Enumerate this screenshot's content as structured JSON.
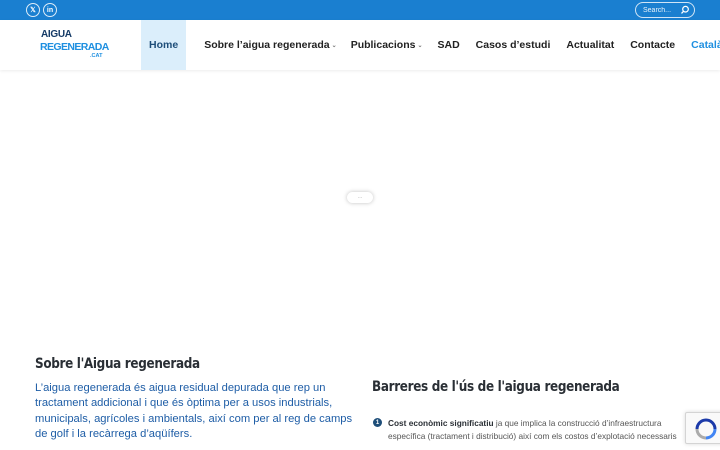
{
  "topbar": {
    "social": [
      {
        "icon": "x-twitter-icon",
        "glyph": "𝕏"
      },
      {
        "icon": "linkedin-icon",
        "glyph": "in"
      }
    ],
    "search": {
      "placeholder": "Search..."
    }
  },
  "header": {
    "logo": {
      "line1": "AIGUA",
      "line2": "REGENERADA",
      "line3": ".CAT"
    },
    "nav": [
      {
        "label": "Home",
        "active": true
      },
      {
        "label": "Sobre l’aigua regenerada",
        "has_submenu": true
      },
      {
        "label": "Publicacions",
        "has_submenu": true
      },
      {
        "label": "SAD"
      },
      {
        "label": "Casos d’estudi"
      },
      {
        "label": "Actualitat"
      },
      {
        "label": "Contacte"
      },
      {
        "label": "Català",
        "has_submenu": true
      }
    ]
  },
  "slider": {
    "loader_text": "⋯"
  },
  "left": {
    "title": "Sobre l'Aigua regenerada",
    "text": "L’aigua regenerada és aigua residual depurada que rep un tractament addicional i que és òptima per a usos industrials, municipals, agrícoles i ambientals, així com per al reg de camps de golf i la recàrrega d’aqüífers."
  },
  "right": {
    "title": "Barreres de l'ús de l'aigua regenerada",
    "item1": {
      "number": "1",
      "bold": "Cost econòmic significatiu",
      "text": " ja que implica la construcció d’infraestructura específica (tractament i distribució) així com els costos d’explotació necessaris"
    }
  },
  "colors": {
    "topbar": "#1a7fd0",
    "accent": "#1e8fe0",
    "navy": "#1e4e79",
    "link_text": "#1e5da6"
  }
}
